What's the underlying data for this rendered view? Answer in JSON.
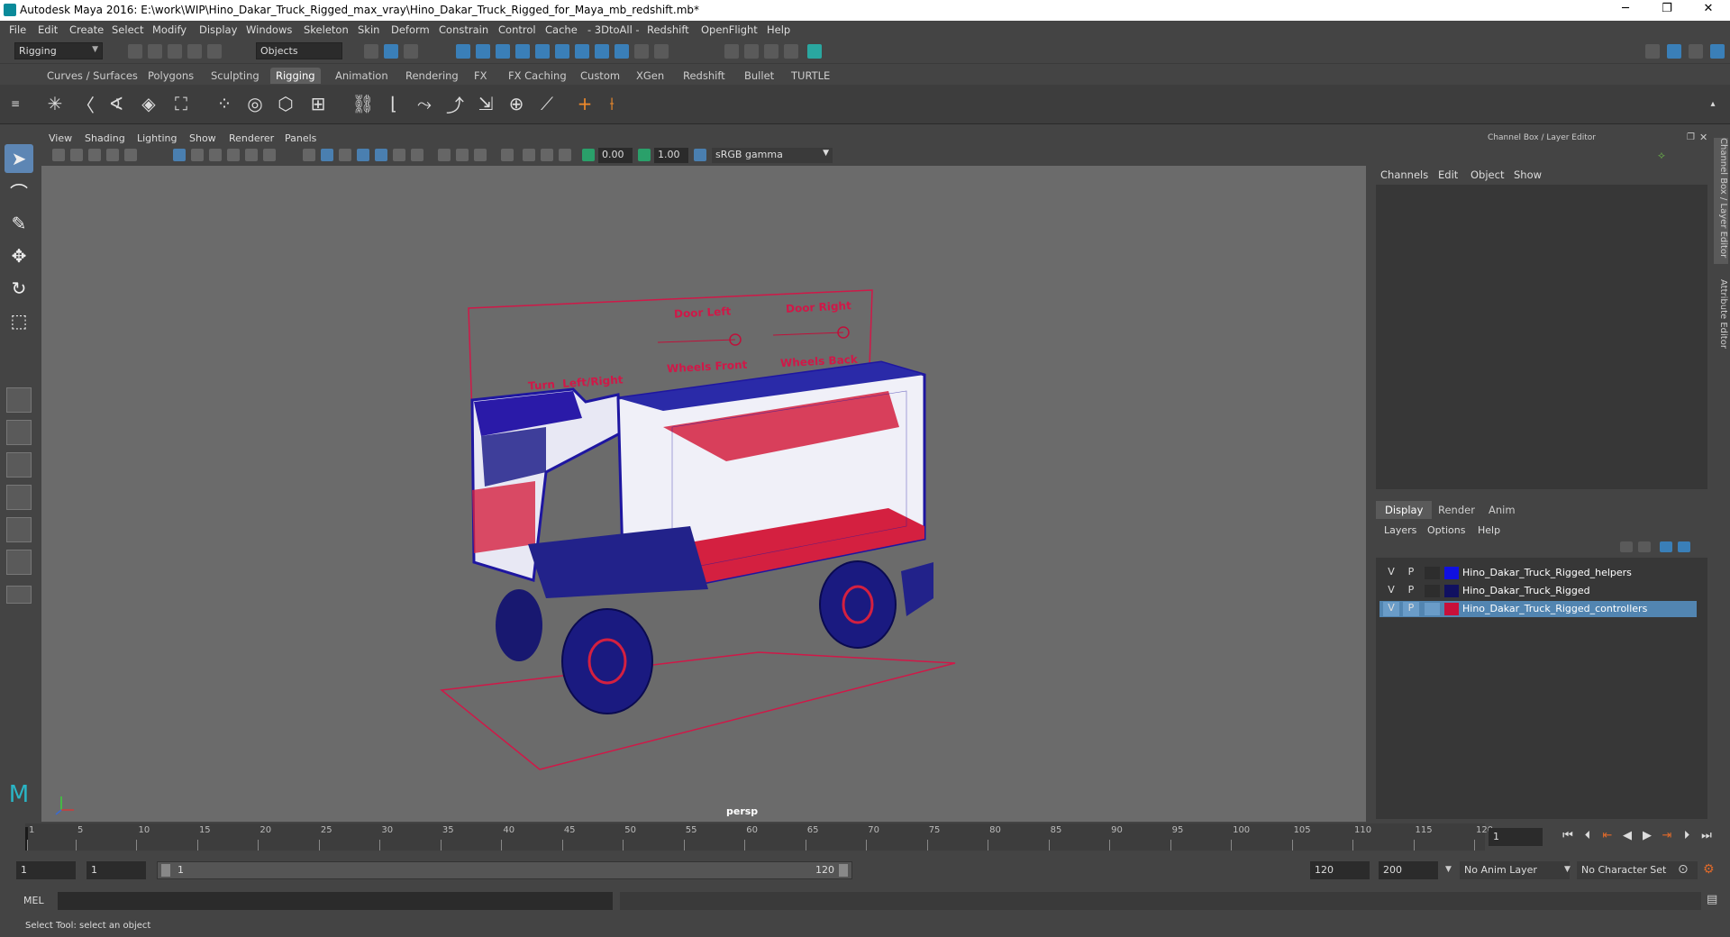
{
  "window": {
    "title": "Autodesk Maya 2016: E:\\work\\WIP\\Hino_Dakar_Truck_Rigged_max_vray\\Hino_Dakar_Truck_Rigged_for_Maya_mb_redshift.mb*",
    "minimize": "─",
    "restore": "❐",
    "close": "✕"
  },
  "menubar": [
    "File",
    "Edit",
    "Create",
    "Select",
    "Modify",
    "Display",
    "Windows",
    "Skeleton",
    "Skin",
    "Deform",
    "Constrain",
    "Control",
    "Cache",
    "- 3DtoAll -",
    "Redshift",
    "OpenFlight",
    "Help"
  ],
  "statusline": {
    "menuset": "Rigging",
    "selection_mode": "Objects"
  },
  "shelf_tabs": [
    "Curves / Surfaces",
    "Polygons",
    "Sculpting",
    "Rigging",
    "Animation",
    "Rendering",
    "FX",
    "FX Caching",
    "Custom",
    "XGen",
    "Redshift",
    "Bullet",
    "TURTLE"
  ],
  "shelf_active_tab": "Rigging",
  "viewport": {
    "menu": [
      "View",
      "Shading",
      "Lighting",
      "Show",
      "Renderer",
      "Panels"
    ],
    "exposure": "0.00",
    "gamma": "1.00",
    "color_space": "sRGB gamma",
    "camera_label": "persp"
  },
  "rig_panel": {
    "labels": [
      "Door Left",
      "Door Right",
      "Turn  Left/Right",
      "Wheels Front",
      "Wheels Back"
    ]
  },
  "channel_box": {
    "header": "Channel Box / Layer Editor",
    "menu": [
      "Channels",
      "Edit",
      "Object",
      "Show"
    ]
  },
  "layer_editor": {
    "tabs": [
      "Display",
      "Render",
      "Anim"
    ],
    "active_tab": "Display",
    "menu": [
      "Layers",
      "Options",
      "Help"
    ],
    "layers": [
      {
        "v": "V",
        "p": "P",
        "color": "#1010e0",
        "name": "Hino_Dakar_Truck_Rigged_helpers",
        "selected": false
      },
      {
        "v": "V",
        "p": "P",
        "color": "#101060",
        "name": "Hino_Dakar_Truck_Rigged",
        "selected": false
      },
      {
        "v": "V",
        "p": "P",
        "color": "#c8103a",
        "name": "Hino_Dakar_Truck_Rigged_controllers",
        "selected": true
      }
    ]
  },
  "side_tabs": [
    "Channel Box / Layer Editor",
    "Attribute Editor"
  ],
  "timeline": {
    "ticks": [
      "1",
      "5",
      "10",
      "15",
      "20",
      "25",
      "30",
      "35",
      "40",
      "45",
      "50",
      "55",
      "60",
      "65",
      "70",
      "75",
      "80",
      "85",
      "90",
      "95",
      "100",
      "105",
      "110",
      "115",
      "120"
    ],
    "current_frame": "1"
  },
  "range": {
    "start": "1",
    "playback_start": "1",
    "slider_start": "1",
    "slider_end": "120",
    "playback_end": "120",
    "end": "200",
    "anim_layer": "No Anim Layer",
    "character_set": "No Character Set"
  },
  "command_line": {
    "label": "MEL"
  },
  "status_message": "Select Tool: select an object"
}
